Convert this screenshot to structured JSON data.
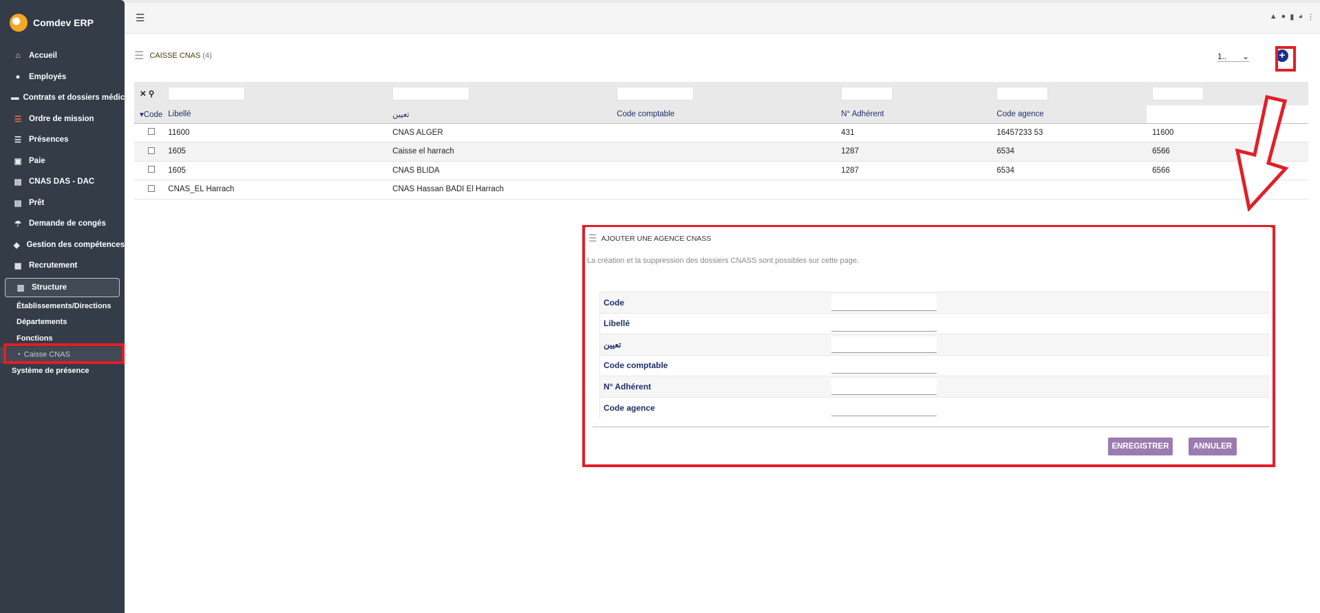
{
  "app": {
    "name": "Comdev ERP"
  },
  "sidebar": {
    "items": [
      {
        "label": "Accueil",
        "icon": "home-icon",
        "glyph": "⌂"
      },
      {
        "label": "Employés",
        "icon": "user-icon",
        "glyph": "●"
      },
      {
        "label": "Contrats et dossiers médic",
        "icon": "folder-icon",
        "glyph": "▬"
      },
      {
        "label": "Ordre de mission",
        "icon": "list-icon",
        "glyph": "☰"
      },
      {
        "label": "Présences",
        "icon": "list-icon",
        "glyph": "☰"
      },
      {
        "label": "Paie",
        "icon": "money-icon",
        "glyph": "▣"
      },
      {
        "label": "CNAS DAS - DAC",
        "icon": "document-icon",
        "glyph": "▤"
      },
      {
        "label": "Prêt",
        "icon": "document-icon",
        "glyph": "▤"
      },
      {
        "label": "Demande de congés",
        "icon": "umbrella-icon",
        "glyph": "☂"
      },
      {
        "label": "Gestion des compétences",
        "icon": "shapes-icon",
        "glyph": "◆"
      },
      {
        "label": "Recrutement",
        "icon": "badge-icon",
        "glyph": "▦"
      },
      {
        "label": "Structure",
        "icon": "building-icon",
        "glyph": "▥"
      }
    ],
    "sub_items": [
      {
        "label": "Établissements/Directions"
      },
      {
        "label": "Départements"
      },
      {
        "label": "Fonctions"
      },
      {
        "label": "Caisse CNAS"
      }
    ],
    "after": "Système de présence"
  },
  "list": {
    "title": "CAISSE CNAS",
    "count": "(4)",
    "pager": "1..",
    "columns": [
      "Code",
      "Libellé",
      "تعيين",
      "Code comptable",
      "N° Adhérent",
      "Code agence"
    ],
    "rows": [
      [
        "11600",
        "CNAS ALGER",
        "",
        "431",
        "16457233 53",
        "11600"
      ],
      [
        "1605",
        "Caisse el harrach",
        "",
        "1287",
        "6534",
        "6566"
      ],
      [
        "1605",
        "CNAS BLIDA",
        "",
        "1287",
        "6534",
        "6566"
      ],
      [
        "CNAS_EL Harrach",
        "CNAS Hassan BADI El Harrach",
        "",
        "",
        "",
        ""
      ]
    ]
  },
  "modal": {
    "title": "AJOUTER UNE AGENCE CNASS",
    "description": "La création et la suppression des dossiers CNASS sont possibles sur cette page.",
    "fields": [
      "Code",
      "Libellé",
      "تعيين",
      "Code comptable",
      "N° Adhérent",
      "Code agence"
    ],
    "save_label": "ENREGISTRER",
    "cancel_label": "ANNULER"
  },
  "colors": {
    "sidebar": "#333c47",
    "highlight": "#e21f26",
    "button": "#9b7bb0",
    "header_text": "#1e2f6b"
  }
}
